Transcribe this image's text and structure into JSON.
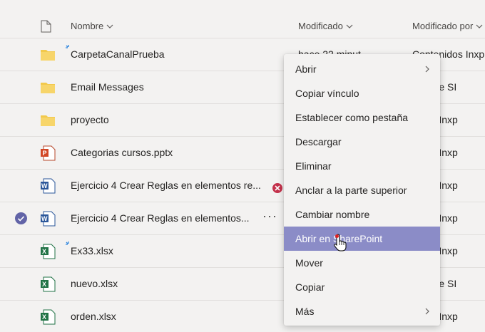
{
  "header": {
    "name_label": "Nombre",
    "modified_label": "Modificado",
    "modified_by_label": "Modificado por"
  },
  "files": [
    {
      "type": "folder",
      "name": "CarpetaCanalPrueba",
      "modified": "hace 22 minut",
      "modified_by": "Contenidos Inxp",
      "new": true
    },
    {
      "type": "folder",
      "name": "Email Messages",
      "modified": "",
      "modified_by": "ción de SI",
      "new": false
    },
    {
      "type": "folder",
      "name": "proyecto",
      "modified": "",
      "modified_by": "nidos Inxp",
      "new": false
    },
    {
      "type": "pptx",
      "name": "Categorias cursos.pptx",
      "modified": "",
      "modified_by": "nidos Inxp",
      "new": false
    },
    {
      "type": "docx",
      "name": "Ejercicio 4 Crear Reglas en elementos re...",
      "modified": "",
      "modified_by": "nidos Inxp",
      "new": false,
      "error": true
    },
    {
      "type": "docx",
      "name": "Ejercicio 4 Crear Reglas en elementos...",
      "modified": "",
      "modified_by": "nidos Inxp",
      "new": false,
      "selected": true
    },
    {
      "type": "xlsx",
      "name": "Ex33.xlsx",
      "modified": "",
      "modified_by": "nidos Inxp",
      "new": true
    },
    {
      "type": "xlsx",
      "name": "nuevo.xlsx",
      "modified": "",
      "modified_by": "ción de SI",
      "new": false
    },
    {
      "type": "xlsx",
      "name": "orden.xlsx",
      "modified": "",
      "modified_by": "nidos Inxp",
      "new": false
    }
  ],
  "row_actions": {
    "more_label": "···"
  },
  "context_menu": {
    "items": [
      {
        "label": "Abrir",
        "submenu": true
      },
      {
        "label": "Copiar vínculo"
      },
      {
        "label": "Establecer como pestaña"
      },
      {
        "label": "Descargar"
      },
      {
        "label": "Eliminar"
      },
      {
        "label": "Anclar a la parte superior"
      },
      {
        "label": "Cambiar nombre"
      },
      {
        "label": "Abrir en SharePoint",
        "hover": true
      },
      {
        "label": "Mover"
      },
      {
        "label": "Copiar"
      },
      {
        "label": "Más",
        "submenu": true
      }
    ]
  },
  "colors": {
    "accent": "#6264a7",
    "menu_hover": "#8b8cc7",
    "folder": "#f2c94c",
    "word": "#2b579a",
    "excel": "#217346",
    "powerpoint": "#d24726",
    "error": "#c4314b"
  }
}
